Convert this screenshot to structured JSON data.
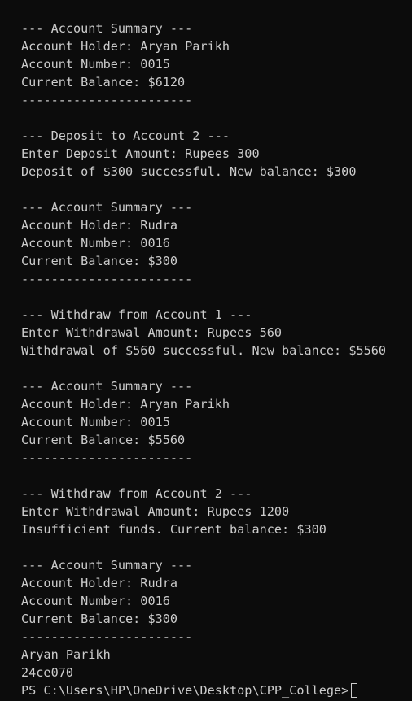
{
  "terminal": {
    "top_fragment": "'",
    "lines": [
      "--- Account Summary ---",
      "Account Holder: Aryan Parikh",
      "Account Number: 0015",
      "Current Balance: $6120",
      "-----------------------",
      "",
      "--- Deposit to Account 2 ---",
      "Enter Deposit Amount: Rupees 300",
      "Deposit of $300 successful. New balance: $300",
      "",
      "--- Account Summary ---",
      "Account Holder: Rudra",
      "Account Number: 0016",
      "Current Balance: $300",
      "-----------------------",
      "",
      "--- Withdraw from Account 1 ---",
      "Enter Withdrawal Amount: Rupees 560",
      "Withdrawal of $560 successful. New balance: $5560",
      "",
      "--- Account Summary ---",
      "Account Holder: Aryan Parikh",
      "Account Number: 0015",
      "Current Balance: $5560",
      "-----------------------",
      "",
      "--- Withdraw from Account 2 ---",
      "Enter Withdrawal Amount: Rupees 1200",
      "Insufficient funds. Current balance: $300",
      "",
      "--- Account Summary ---",
      "Account Holder: Rudra",
      "Account Number: 0016",
      "Current Balance: $300",
      "-----------------------",
      "Aryan Parikh",
      "24ce070"
    ],
    "prompt": "PS C:\\Users\\HP\\OneDrive\\Desktop\\CPP_College>",
    "colors": {
      "background": "#0c0c0c",
      "foreground": "#cccccc"
    }
  }
}
